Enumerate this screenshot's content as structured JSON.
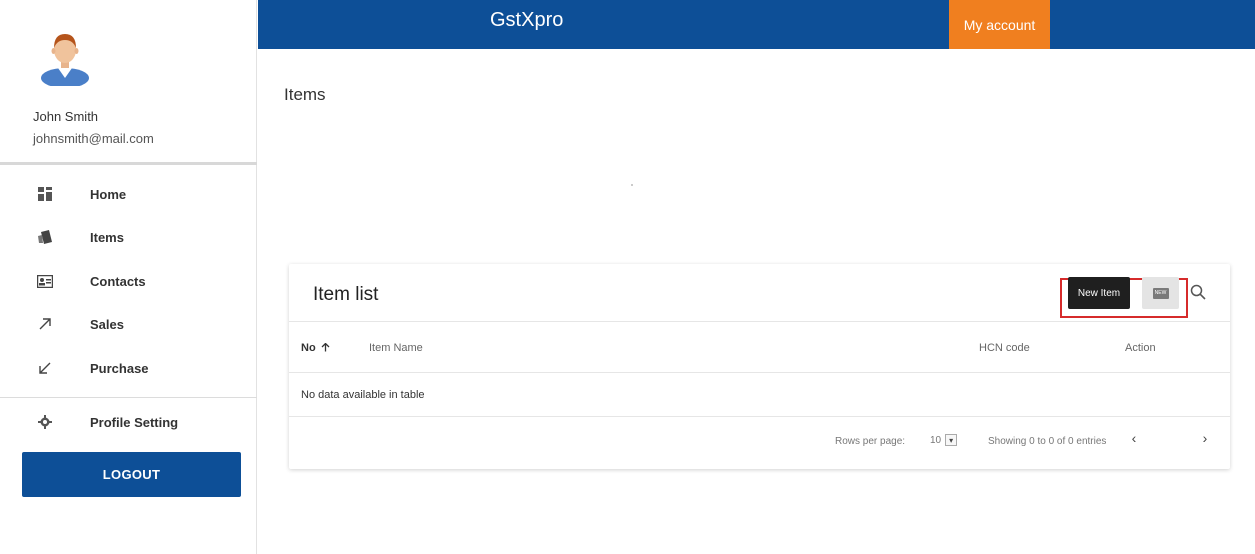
{
  "app": {
    "title": "GstXpro",
    "my_account": "My account"
  },
  "profile": {
    "name": "John Smith",
    "email": "johnsmith@mail.com"
  },
  "sidebar": {
    "items": [
      {
        "label": "Home",
        "icon": "dashboard-icon"
      },
      {
        "label": "Items",
        "icon": "items-icon"
      },
      {
        "label": "Contacts",
        "icon": "contact-card-icon"
      },
      {
        "label": "Sales",
        "icon": "arrow-up-right-icon"
      },
      {
        "label": "Purchase",
        "icon": "arrow-down-left-icon"
      },
      {
        "label": "Profile Setting",
        "icon": "gear-icon"
      }
    ],
    "logout": "LOGOUT"
  },
  "page": {
    "title": "Items"
  },
  "item_list": {
    "title": "Item list",
    "new_item_button": "New Item",
    "new_badge": "NEW",
    "columns": [
      "No",
      "Item Name",
      "HCN code",
      "Action"
    ],
    "empty_message": "No data available in table",
    "rows_per_page_label": "Rows per page:",
    "rows_per_page_value": "10",
    "showing": "Showing 0 to 0 of 0 entries",
    "prev": "‹",
    "next": "›"
  },
  "colors": {
    "primary": "#0d4f97",
    "accent": "#f07f1f",
    "highlight": "#d62b2b"
  }
}
